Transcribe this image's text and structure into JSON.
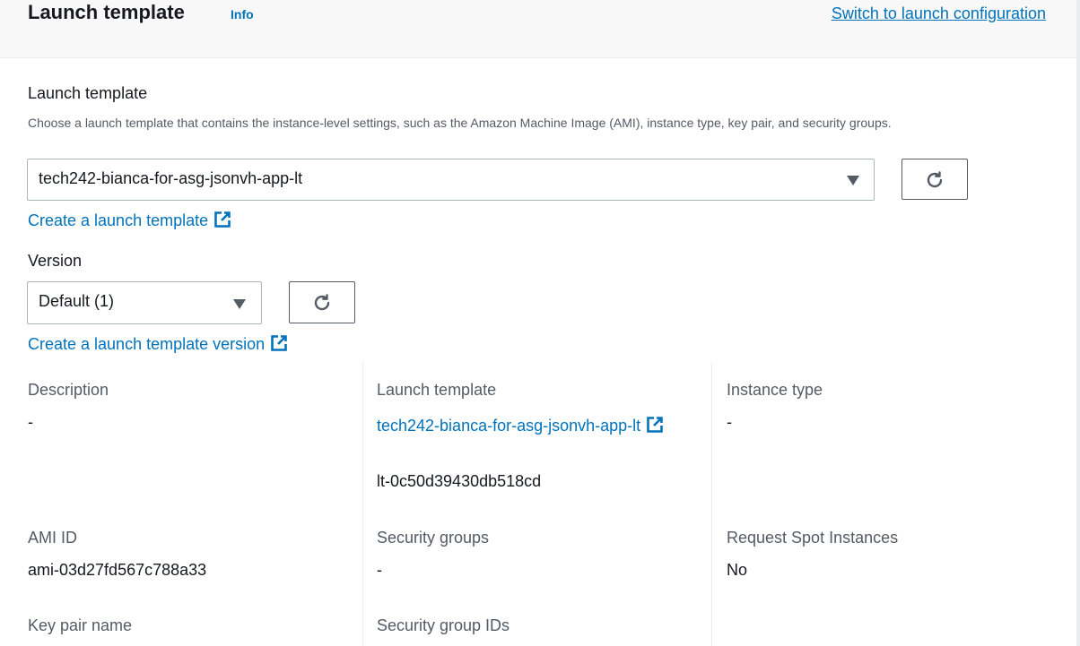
{
  "header": {
    "title": "Launch template",
    "info_label": "Info",
    "switch_link": "Switch to launch configuration"
  },
  "launch_template_field": {
    "label": "Launch template",
    "description": "Choose a launch template that contains the instance-level settings, such as the Amazon Machine Image (AMI), instance type, key pair, and security groups.",
    "selected_value": "tech242-bianca-for-asg-jsonvh-app-lt",
    "create_link": "Create a launch template"
  },
  "version_field": {
    "label": "Version",
    "selected_value": "Default (1)",
    "create_link": "Create a launch template version"
  },
  "details": {
    "description": {
      "label": "Description",
      "value": "-"
    },
    "launch_template": {
      "label": "Launch template",
      "link_text": "tech242-bianca-for-asg-jsonvh-app-lt",
      "id": "lt-0c50d39430db518cd"
    },
    "instance_type": {
      "label": "Instance type",
      "value": "-"
    },
    "ami_id": {
      "label": "AMI ID",
      "value": "ami-03d27fd567c788a33"
    },
    "security_groups": {
      "label": "Security groups",
      "value": "-"
    },
    "request_spot": {
      "label": "Request Spot Instances",
      "value": "No"
    },
    "key_pair": {
      "label": "Key pair name"
    },
    "security_group_ids": {
      "label": "Security group IDs"
    }
  },
  "colors": {
    "link": "#0073bb",
    "text": "#16191f",
    "secondary_text": "#545b64",
    "header_bg": "#f8f8f8"
  },
  "icons": {
    "external": "external-link-icon",
    "refresh": "refresh-icon",
    "dropdown": "caret-down-icon"
  }
}
